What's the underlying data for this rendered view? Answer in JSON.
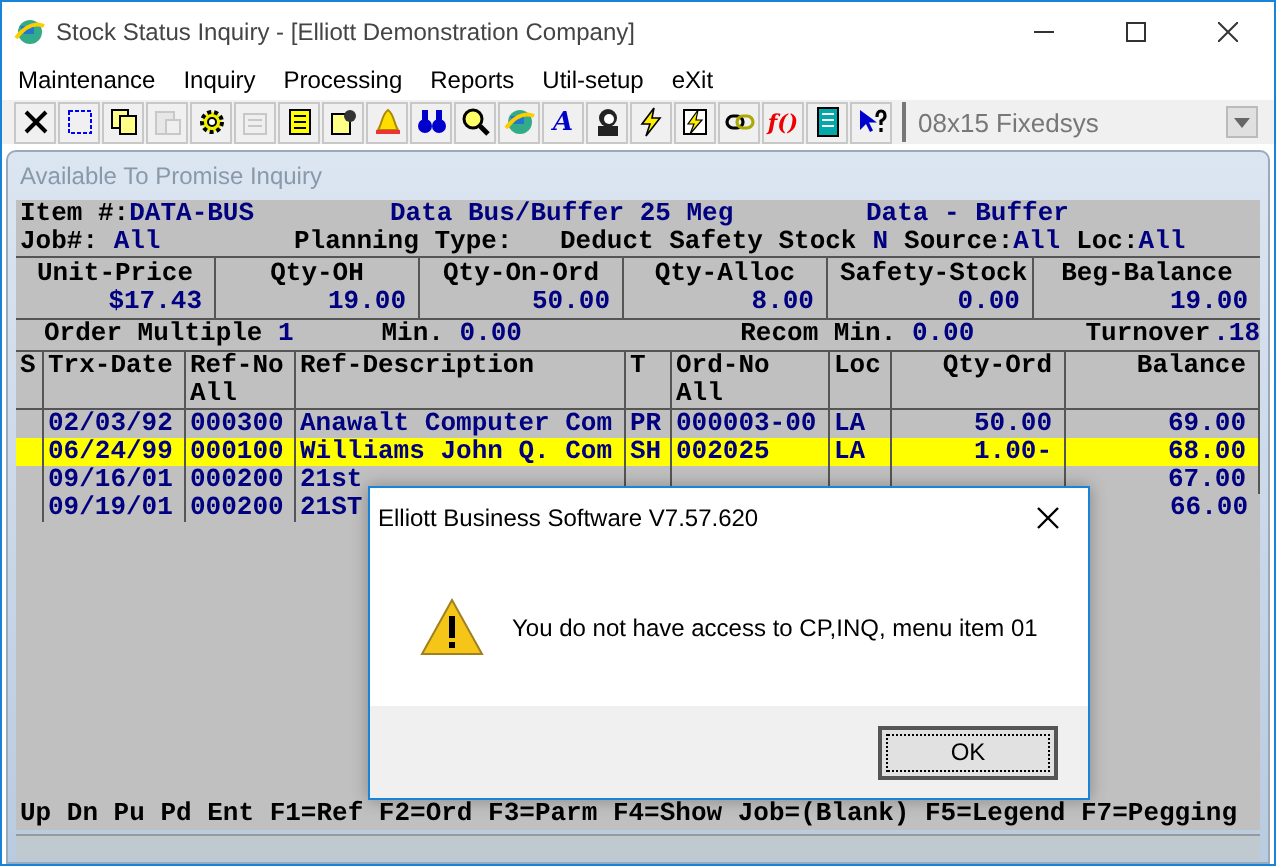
{
  "window": {
    "title": "Stock Status Inquiry - [Elliott Demonstration Company]"
  },
  "menu": [
    "Maintenance",
    "Inquiry",
    "Processing",
    "Reports",
    "Util-setup",
    "eXit"
  ],
  "toolbar": {
    "buttons": [
      {
        "disabled": false
      },
      {
        "disabled": false
      },
      {
        "disabled": false
      },
      {
        "disabled": true
      },
      {
        "disabled": false
      },
      {
        "disabled": true
      },
      {
        "disabled": false
      },
      {
        "disabled": false
      },
      {
        "disabled": false
      },
      {
        "disabled": false
      },
      {
        "disabled": false
      },
      {
        "disabled": false
      },
      {
        "label": "A",
        "disabled": false
      },
      {
        "disabled": false
      },
      {
        "disabled": false
      },
      {
        "disabled": false
      },
      {
        "disabled": false
      },
      {
        "label": "f()",
        "disabled": false
      },
      {
        "disabled": false
      },
      {
        "disabled": false
      }
    ],
    "font_select": {
      "value": "08x15 Fixedsys",
      "disabled": true
    }
  },
  "child_window": {
    "title": "Available To Promise Inquiry"
  },
  "header": {
    "item_label": "Item #:",
    "item": "DATA-BUS",
    "description": "Data Bus/Buffer 25 Meg",
    "category": "Data - Buffer",
    "job_label": "Job#:",
    "job": "All",
    "planning_label": "Planning Type:",
    "planning_type": "Deduct Safety Stock",
    "planning_flag": "N",
    "source_label": "Source:",
    "source": "All",
    "loc_label": "Loc:",
    "loc": "All"
  },
  "summary": [
    {
      "label": "Unit-Price",
      "value": "$17.43"
    },
    {
      "label": "Qty-OH",
      "value": "19.00"
    },
    {
      "label": "Qty-On-Ord",
      "value": "50.00"
    },
    {
      "label": "Qty-Alloc",
      "value": "8.00"
    },
    {
      "label": "Safety-Stock",
      "value": "0.00"
    },
    {
      "label": "Beg-Balance",
      "value": "19.00"
    }
  ],
  "order_line": [
    {
      "label": "Order Multiple",
      "value": "1"
    },
    {
      "label": "Min.",
      "value": "0.00"
    },
    {
      "label": "Recom Min.",
      "value": "0.00"
    },
    {
      "label": "Turnover",
      "value": ".18"
    }
  ],
  "table": {
    "columns": [
      {
        "label": "S"
      },
      {
        "label": "Trx-Date"
      },
      {
        "label": "Ref-No",
        "filter": "All"
      },
      {
        "label": "Ref-Description"
      },
      {
        "label": "T"
      },
      {
        "label": "Ord-No",
        "filter": "All"
      },
      {
        "label": "Loc"
      },
      {
        "label": "Qty-Ord"
      },
      {
        "label": "Balance"
      }
    ],
    "rows": [
      {
        "trx_date": "02/03/92",
        "ref_no": "000300",
        "ref_description": "Anawalt Computer Com",
        "t": "PR",
        "ord_no": "000003-00",
        "loc": "LA",
        "qty_ord": "50.00",
        "balance": "69.00",
        "selected": false
      },
      {
        "trx_date": "06/24/99",
        "ref_no": "000100",
        "ref_description": "Williams John Q. Com",
        "t": "SH",
        "ord_no": "002025",
        "loc": "LA",
        "qty_ord": "1.00-",
        "balance": "68.00",
        "selected": true
      },
      {
        "trx_date": "09/16/01",
        "ref_no": "000200",
        "ref_description": "21st",
        "balance": "67.00",
        "selected": false
      },
      {
        "trx_date": "09/19/01",
        "ref_no": "000200",
        "ref_description": "21ST",
        "balance": "66.00",
        "selected": false
      }
    ]
  },
  "status_bar": "Up Dn Pu Pd Ent F1=Ref F2=Ord F3=Parm F4=Show Job=(Blank) F5=Legend F7=Pegging",
  "dialog": {
    "title": "Elliott Business Software V7.57.620",
    "message": "You do not have access to CP,INQ, menu item 01",
    "button": "OK"
  }
}
